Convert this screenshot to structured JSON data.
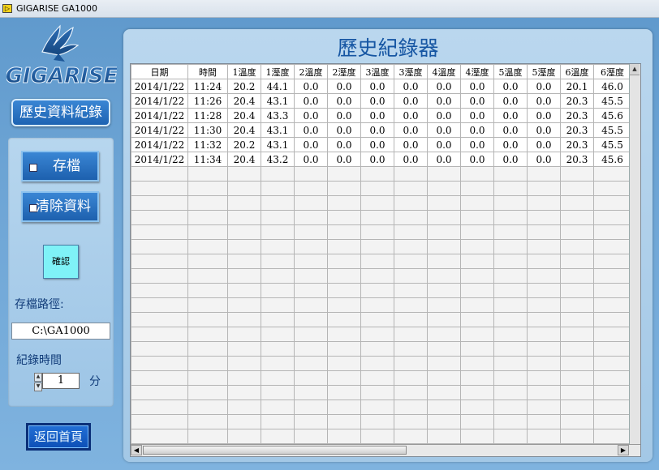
{
  "window": {
    "icon_label": "▷",
    "title_app": "GIGARISE",
    "title_model": "GA1000"
  },
  "brand": {
    "logo_text": "GIGARISE"
  },
  "sidebar": {
    "section_label": "歷史資料紀錄",
    "save_label": "存檔",
    "clear_label": "清除資料",
    "confirm_label": "確認",
    "path_label": "存檔路徑:",
    "path_value": "C:\\GA1000",
    "record_time_label": "紀錄時間",
    "record_time_value": "1",
    "record_time_unit": "分",
    "back_label": "返回首頁"
  },
  "main": {
    "title": "歷史紀錄器",
    "columns": [
      "日期",
      "時間",
      "1溫度",
      "1溼度",
      "2溫度",
      "2溼度",
      "3溫度",
      "3溼度",
      "4溫度",
      "4溼度",
      "5溫度",
      "5溼度",
      "6溫度",
      "6溼度"
    ],
    "rows": [
      [
        "2014/1/22",
        "11:24",
        "20.2",
        "44.1",
        "0.0",
        "0.0",
        "0.0",
        "0.0",
        "0.0",
        "0.0",
        "0.0",
        "0.0",
        "20.1",
        "46.0"
      ],
      [
        "2014/1/22",
        "11:26",
        "20.4",
        "43.1",
        "0.0",
        "0.0",
        "0.0",
        "0.0",
        "0.0",
        "0.0",
        "0.0",
        "0.0",
        "20.3",
        "45.5"
      ],
      [
        "2014/1/22",
        "11:28",
        "20.4",
        "43.3",
        "0.0",
        "0.0",
        "0.0",
        "0.0",
        "0.0",
        "0.0",
        "0.0",
        "0.0",
        "20.3",
        "45.6"
      ],
      [
        "2014/1/22",
        "11:30",
        "20.4",
        "43.1",
        "0.0",
        "0.0",
        "0.0",
        "0.0",
        "0.0",
        "0.0",
        "0.0",
        "0.0",
        "20.3",
        "45.5"
      ],
      [
        "2014/1/22",
        "11:32",
        "20.2",
        "43.1",
        "0.0",
        "0.0",
        "0.0",
        "0.0",
        "0.0",
        "0.0",
        "0.0",
        "0.0",
        "20.3",
        "45.5"
      ],
      [
        "2014/1/22",
        "11:34",
        "20.4",
        "43.2",
        "0.0",
        "0.0",
        "0.0",
        "0.0",
        "0.0",
        "0.0",
        "0.0",
        "0.0",
        "20.3",
        "45.6"
      ]
    ]
  },
  "colors": {
    "accent": "#1d63b2",
    "title": "#1656a3",
    "confirm": "#7ff2f7"
  }
}
